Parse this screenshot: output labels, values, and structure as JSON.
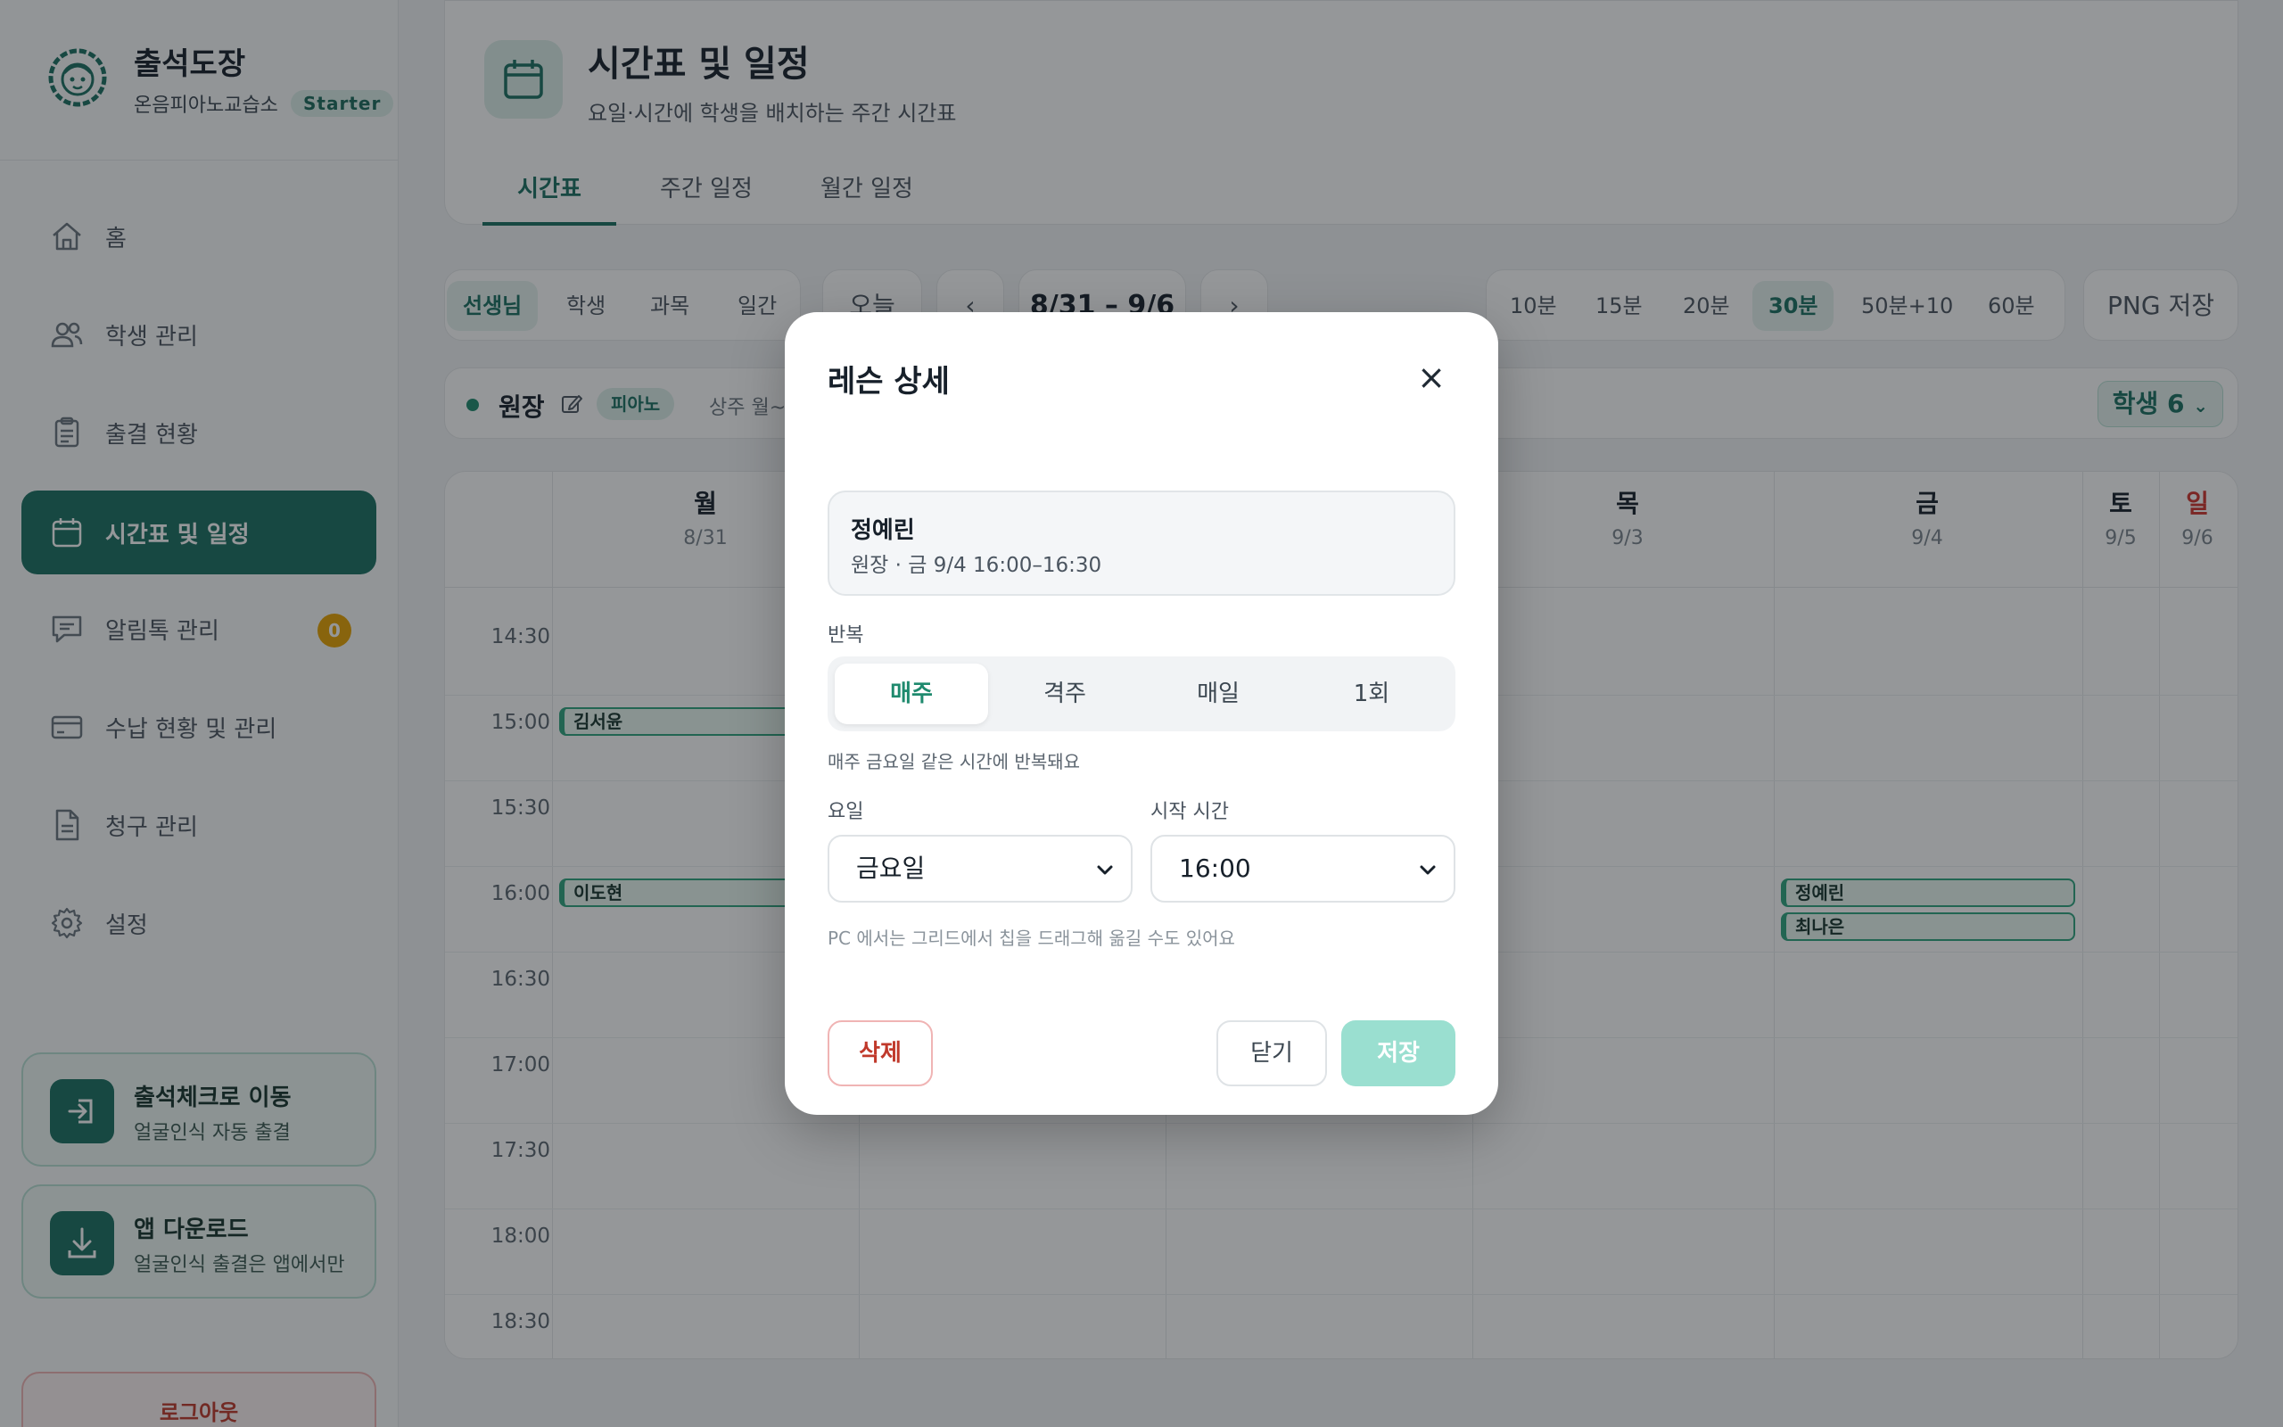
{
  "brand": {
    "title": "출석도장",
    "academy": "온음피아노교습소",
    "plan": "Starter"
  },
  "sidebar": {
    "items": [
      {
        "label": "홈",
        "icon": "home-icon"
      },
      {
        "label": "학생 관리",
        "icon": "users-icon"
      },
      {
        "label": "출결 현황",
        "icon": "clipboard-icon"
      },
      {
        "label": "시간표 및 일정",
        "icon": "calendar-icon",
        "active": true
      },
      {
        "label": "알림톡 관리",
        "icon": "chat-icon",
        "count": "0"
      },
      {
        "label": "수납 현황 및 관리",
        "icon": "card-icon"
      },
      {
        "label": "청구 관리",
        "icon": "document-icon"
      },
      {
        "label": "설정",
        "icon": "gear-icon"
      }
    ],
    "promos": [
      {
        "title": "출석체크로 이동",
        "subtitle": "얼굴인식 자동 출결",
        "icon": "login-icon"
      },
      {
        "title": "앱 다운로드",
        "subtitle": "얼굴인식 출결은 앱에서만",
        "icon": "download-icon"
      }
    ],
    "logout": "로그아웃"
  },
  "header": {
    "title": "시간표 및 일정",
    "subtitle": "요일·시간에 학생을 배치하는 주간 시간표",
    "tabs": [
      "시간표",
      "주간 일정",
      "월간 일정"
    ]
  },
  "toolbar": {
    "view_modes": [
      "선생님",
      "학생",
      "과목",
      "일간"
    ],
    "today": "오늘",
    "prev": "‹",
    "range": "8/31 – 9/6",
    "next": "›",
    "durations": [
      "10분",
      "15분",
      "20분",
      "30분",
      "50분+10",
      "60분"
    ],
    "export": "PNG 저장"
  },
  "teacher": {
    "name": "원장",
    "subject": "피아노",
    "meta": "상주 월~금",
    "students": "학생 6"
  },
  "grid": {
    "days": [
      {
        "name": "월",
        "date": "8/31"
      },
      {
        "name": "목",
        "date": "9/3"
      },
      {
        "name": "금",
        "date": "9/4"
      },
      {
        "name": "토",
        "date": "9/5"
      },
      {
        "name": "일",
        "date": "9/6"
      }
    ],
    "times": [
      "14:30",
      "15:00",
      "15:30",
      "16:00",
      "16:30",
      "17:00",
      "17:30",
      "18:00",
      "18:30"
    ],
    "lessons": [
      {
        "student": "김서윤",
        "day": "월",
        "time": "15:00"
      },
      {
        "student": "이도현",
        "day": "월",
        "time": "16:00"
      },
      {
        "student": "정예린",
        "day": "금",
        "time": "16:00"
      },
      {
        "student": "최나은",
        "day": "금",
        "time": "16:00"
      }
    ]
  },
  "modal": {
    "title": "레슨 상세",
    "close": "×",
    "lesson_name": "정예린",
    "lesson_meta": "원장 · 금 9/4 16:00–16:30",
    "repeat_label": "반복",
    "repeat_options": [
      "매주",
      "격주",
      "매일",
      "1회"
    ],
    "repeat_hint": "매주 금요일 같은 시간에 반복돼요",
    "day_label": "요일",
    "day_value": "금요일",
    "start_label": "시작 시간",
    "start_value": "16:00",
    "drag_hint": "PC 에서는 그리드에서 칩을 드래그해 옮길 수도 있어요",
    "delete": "삭제",
    "close_btn": "닫기",
    "save": "저장"
  },
  "colors": {
    "brand": "#1a6f61",
    "accent_light": "#dcefe9",
    "danger": "#c0392b",
    "save_disabled": "#9adfd0"
  }
}
